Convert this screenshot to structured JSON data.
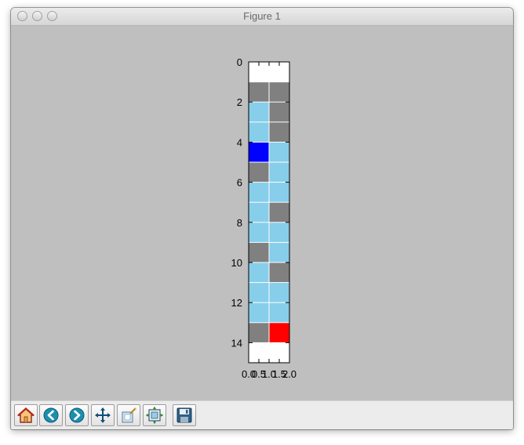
{
  "window": {
    "title": "Figure 1",
    "toolbar": [
      {
        "name": "home-button",
        "icon": "home-icon",
        "tooltip": "Reset original view"
      },
      {
        "name": "back-button",
        "icon": "back-arrow-icon",
        "tooltip": "Back to previous view"
      },
      {
        "name": "forward-button",
        "icon": "forward-arrow-icon",
        "tooltip": "Forward to next view"
      },
      {
        "name": "pan-button",
        "icon": "pan-arrows-icon",
        "tooltip": "Pan axes"
      },
      {
        "name": "zoom-button",
        "icon": "zoom-rect-icon",
        "tooltip": "Zoom to rectangle"
      },
      {
        "name": "subplots-button",
        "icon": "subplots-icon",
        "tooltip": "Configure subplots"
      },
      {
        "name": "save-button",
        "icon": "floppy-disk-icon",
        "tooltip": "Save the figure"
      }
    ]
  },
  "chart_data": {
    "type": "heatmap",
    "title": "",
    "xlabel": "",
    "ylabel": "",
    "x_ticks": [
      "0.0",
      "0.5",
      "1.0",
      "1.5",
      "2.0"
    ],
    "y_ticks": [
      "0",
      "2",
      "4",
      "6",
      "8",
      "10",
      "12",
      "14"
    ],
    "xlim": [
      0,
      2
    ],
    "ylim": [
      15,
      0
    ],
    "colors": {
      "W": "#ffffff",
      "G": "#808080",
      "L": "#87ceeb",
      "B": "#0000ff",
      "R": "#ff0000"
    },
    "grid": [
      [
        "W",
        "W"
      ],
      [
        "G",
        "G"
      ],
      [
        "L",
        "G"
      ],
      [
        "L",
        "G"
      ],
      [
        "B",
        "L"
      ],
      [
        "G",
        "L"
      ],
      [
        "L",
        "L"
      ],
      [
        "L",
        "G"
      ],
      [
        "L",
        "L"
      ],
      [
        "G",
        "L"
      ],
      [
        "L",
        "G"
      ],
      [
        "L",
        "L"
      ],
      [
        "L",
        "L"
      ],
      [
        "G",
        "R"
      ],
      [
        "W",
        "W"
      ]
    ]
  }
}
